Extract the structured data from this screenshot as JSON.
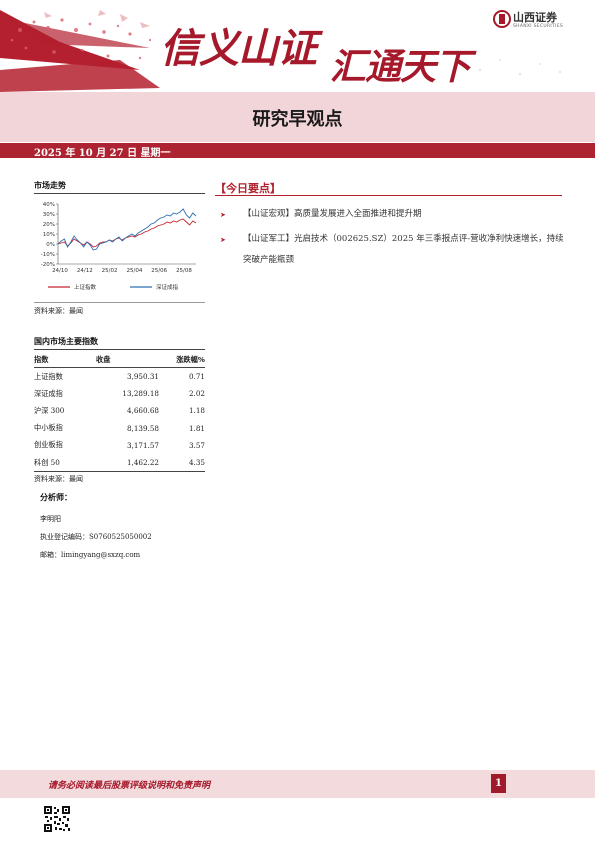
{
  "header": {
    "slogan_part1": "信义山证",
    "slogan_part2": "汇通天下",
    "logo_name": "山西证券",
    "logo_sub": "SHANXI SECURITIES"
  },
  "title": "研究早观点",
  "date_line": "2025 年 10 月 27 日   星期一",
  "market_trend": {
    "heading": "市场走势",
    "source": "资料来源：最闻",
    "chart_data": {
      "type": "line",
      "title": "",
      "x_tick_labels": [
        "24/10",
        "24/12",
        "25/02",
        "25/04",
        "25/06",
        "25/08"
      ],
      "y_tick_labels": [
        "40%",
        "30%",
        "20%",
        "10%",
        "0%",
        "-10%",
        "-20%"
      ],
      "ylim": [
        -20,
        40
      ],
      "grid": false,
      "legend_position": "bottom",
      "colors": {
        "上证指数": "#c0272d",
        "深证成指": "#2f6fb0"
      },
      "series": [
        {
          "name": "上证指数",
          "values": [
            0,
            1,
            2,
            -2,
            1,
            5,
            3,
            1,
            -1,
            2,
            0,
            -3,
            -2,
            1,
            2,
            2,
            4,
            3,
            5,
            6,
            4,
            6,
            7,
            8,
            7,
            9,
            10,
            12,
            13,
            15,
            16,
            18,
            19,
            20,
            22,
            21,
            23,
            22,
            24,
            25,
            22,
            19,
            23,
            21
          ]
        },
        {
          "name": "深证成指",
          "values": [
            0,
            3,
            5,
            -3,
            2,
            8,
            4,
            1,
            -3,
            2,
            -1,
            -6,
            -5,
            0,
            1,
            2,
            4,
            2,
            5,
            7,
            3,
            6,
            8,
            10,
            8,
            11,
            13,
            15,
            17,
            20,
            21,
            24,
            26,
            27,
            29,
            28,
            31,
            30,
            32,
            35,
            29,
            26,
            31,
            28
          ]
        }
      ]
    }
  },
  "market_table": {
    "heading": "国内市场主要指数",
    "columns": [
      "指数",
      "收盘",
      "涨跌幅%"
    ],
    "rows": [
      [
        "上证指数",
        "3,950.31",
        "0.71"
      ],
      [
        "深证成指",
        "13,289.18",
        "2.02"
      ],
      [
        "沪深 300",
        "4,660.68",
        "1.18"
      ],
      [
        "中小板指",
        "8,139.58",
        "1.81"
      ],
      [
        "创业板指",
        "3,171.57",
        "3.57"
      ],
      [
        "科创 50",
        "1,462.22",
        "4.35"
      ]
    ],
    "source": "资料来源：最闻"
  },
  "analyst": {
    "heading": "分析师：",
    "name": "李明阳",
    "license": "执业登记编码：S0760525050002",
    "email": "邮箱：limingyang@sxzq.com"
  },
  "today": {
    "heading": "【今日要点】",
    "items": [
      "【山证宏观】高质量发展进入全面推进和提升期",
      "【山证军工】光启技术（002625.SZ）2025 年三季报点评-营收净利快速增长，持续突破产能瓶颈"
    ]
  },
  "footer": {
    "disclaimer": "请务必阅读最后股票评级说明和免责声明",
    "page_number": "1"
  }
}
